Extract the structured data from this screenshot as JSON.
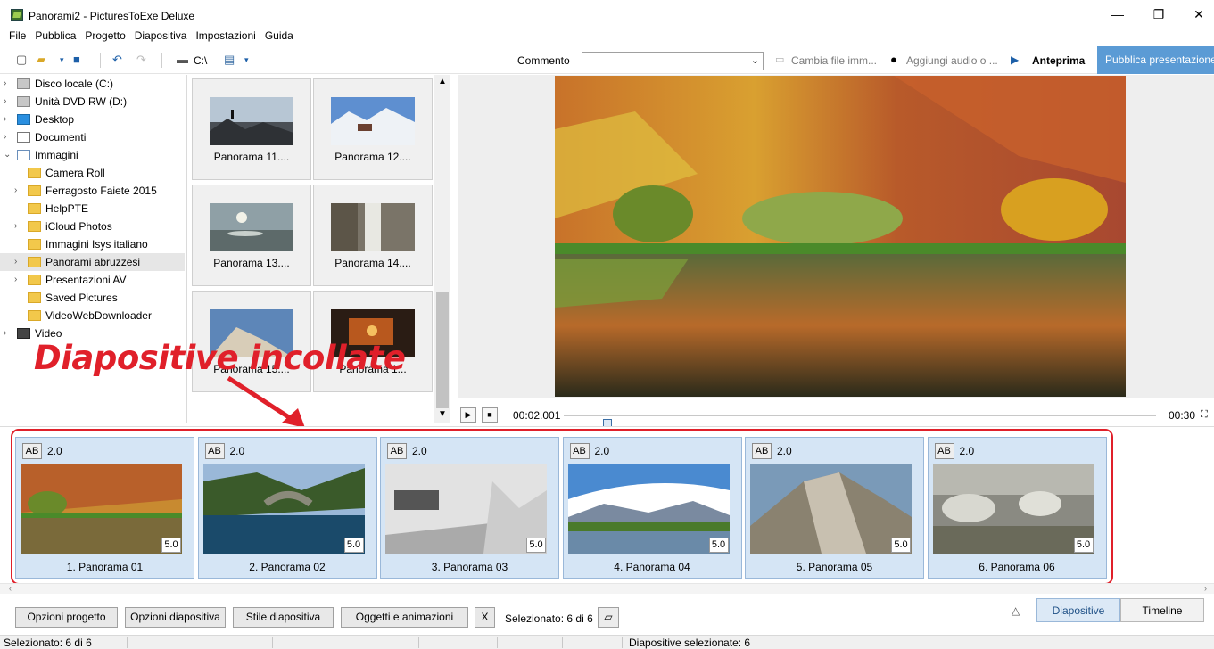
{
  "window": {
    "title": "Panorami2 - PicturesToExe Deluxe",
    "controls": {
      "minimize": "—",
      "maximize": "❐",
      "close": "✕"
    }
  },
  "menu": [
    "File",
    "Pubblica",
    "Progetto",
    "Diapositiva",
    "Impostazioni",
    "Guida"
  ],
  "toolbar": {
    "path_label": "C:\\",
    "comment_label": "Commento",
    "comment_value": "",
    "change_file_label": "Cambia file imm...",
    "add_audio_label": "Aggiungi audio o ...",
    "preview_label": "Anteprima",
    "publish_label": "Pubblica presentazione"
  },
  "tree": [
    {
      "label": "Disco locale (C:)",
      "icon": "drive-icon",
      "expand": "›",
      "indent": 0
    },
    {
      "label": "Unità DVD RW (D:)",
      "icon": "dvd-icon",
      "expand": "›",
      "indent": 0
    },
    {
      "label": "Desktop",
      "icon": "desktop-icon",
      "expand": "›",
      "indent": 0
    },
    {
      "label": "Documenti",
      "icon": "documents-icon",
      "expand": "›",
      "indent": 0
    },
    {
      "label": "Immagini",
      "icon": "pictures-icon",
      "expand": "⌄",
      "indent": 0
    },
    {
      "label": "Camera Roll",
      "icon": "folder-icon",
      "expand": "",
      "indent": 1
    },
    {
      "label": "Ferragosto Faiete 2015",
      "icon": "folder-icon",
      "expand": "›",
      "indent": 1
    },
    {
      "label": "HelpPTE",
      "icon": "folder-icon",
      "expand": "",
      "indent": 1
    },
    {
      "label": "iCloud Photos",
      "icon": "folder-icon",
      "expand": "›",
      "indent": 1
    },
    {
      "label": "Immagini Isys italiano",
      "icon": "folder-icon",
      "expand": "",
      "indent": 1
    },
    {
      "label": "Panorami abruzzesi",
      "icon": "folder-icon",
      "expand": "›",
      "indent": 1,
      "selected": true
    },
    {
      "label": "Presentazioni AV",
      "icon": "folder-icon",
      "expand": "›",
      "indent": 1
    },
    {
      "label": "Saved Pictures",
      "icon": "folder-icon",
      "expand": "",
      "indent": 1
    },
    {
      "label": "VideoWebDownloader",
      "icon": "folder-icon",
      "expand": "",
      "indent": 1
    },
    {
      "label": "Video",
      "icon": "video-icon",
      "expand": "›",
      "indent": 0
    }
  ],
  "thumbnails": [
    "Panorama 11....",
    "Panorama 12....",
    "Panorama 13....",
    "Panorama 14....",
    "Panorama 15....",
    "Panorama 1..."
  ],
  "annotation": "Diapositive incollate",
  "player": {
    "current_time": "00:02.001",
    "total_time": "00:30",
    "position_fraction": 0.067
  },
  "slides": [
    {
      "caption": "1. Panorama 01",
      "ab": "AB",
      "transition": "2.0",
      "duration": "5.0"
    },
    {
      "caption": "2. Panorama 02",
      "ab": "AB",
      "transition": "2.0",
      "duration": "5.0"
    },
    {
      "caption": "3. Panorama 03",
      "ab": "AB",
      "transition": "2.0",
      "duration": "5.0"
    },
    {
      "caption": "4. Panorama 04",
      "ab": "AB",
      "transition": "2.0",
      "duration": "5.0"
    },
    {
      "caption": "5. Panorama 05",
      "ab": "AB",
      "transition": "2.0",
      "duration": "5.0"
    },
    {
      "caption": "6. Panorama 06",
      "ab": "AB",
      "transition": "2.0",
      "duration": "5.0"
    }
  ],
  "bottom": {
    "project_options": "Opzioni progetto",
    "slide_options": "Opzioni diapositiva",
    "slide_style": "Stile diapositiva",
    "objects_animations": "Oggetti e animazioni",
    "x_label": "X",
    "selected_info": "Selezionato: 6 di 6",
    "collapse_glyph": "△",
    "tab_slides": "Diapositive",
    "tab_timeline": "Timeline"
  },
  "status": {
    "left": "Selezionato: 6 di 6",
    "right": "Diapositive selezionate: 6"
  },
  "colors": {
    "accent": "#5b9bd5",
    "annotation": "#e0202a",
    "slide_bg": "#d5e5f5"
  }
}
